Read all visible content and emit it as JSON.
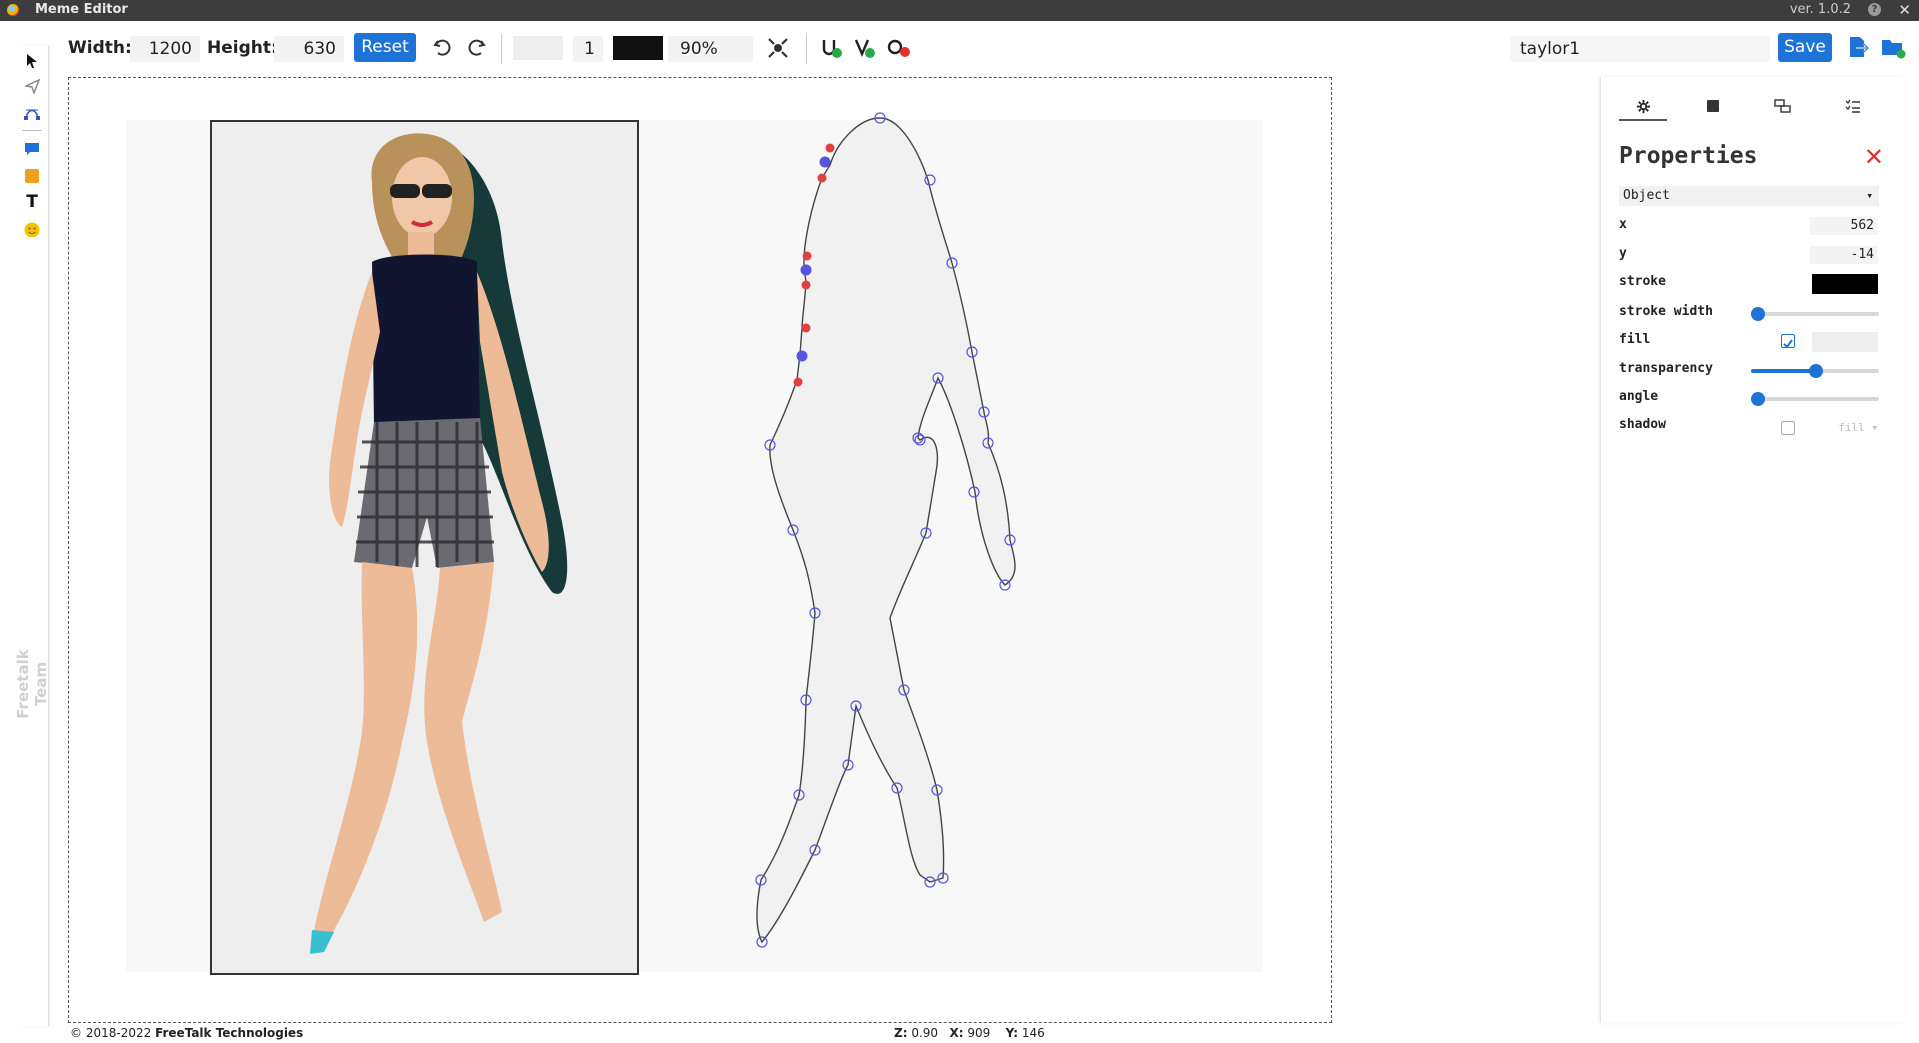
{
  "window": {
    "title": "Meme Editor",
    "version": "ver. 1.0.2",
    "help_icon": "help-icon",
    "close_glyph": "✕"
  },
  "toolbar": {
    "width_label": "Width:",
    "width_value": "1200",
    "height_label": "Height:",
    "height_value": "630",
    "reset_label": "Reset",
    "stroke_width_value": "1",
    "zoom_value": "90%",
    "filename": "taylor1",
    "save_label": "Save",
    "fill_color": "#eeeeee",
    "stroke_color": "#111111"
  },
  "left_tools": [
    "pointer-icon",
    "send-icon",
    "path-edit-icon",
    "speech-bubble-icon",
    "rectangle-icon",
    "text-icon",
    "emoji-icon"
  ],
  "left_vertical_text": "Freetalk Team",
  "properties": {
    "tabs": [
      "gear-icon",
      "square-icon",
      "layers-icon",
      "checklist-icon"
    ],
    "title": "Properties",
    "object_type": "Object",
    "rows": {
      "x_label": "x",
      "x_value": "562",
      "y_label": "y",
      "y_value": "-14",
      "stroke_label": "stroke",
      "stroke_color": "#000000",
      "stroke_width_label": "stroke width",
      "stroke_width_level": 0.0,
      "fill_label": "fill",
      "fill_checked": true,
      "fill_color": "#eeeeee",
      "transparency_label": "transparency",
      "transparency_level": 0.5,
      "angle_label": "angle",
      "angle_level": 0.0,
      "shadow_label": "shadow",
      "shadow_checked": false,
      "shadow_mode": "fill"
    }
  },
  "status": {
    "copyright_prefix": "© 2018-2022",
    "company": "FreeTalk Technologies",
    "z_label": "Z:",
    "z_value": "0.90",
    "x_label": "X:",
    "x_value": "909",
    "y_label": "Y:",
    "y_value": "146"
  },
  "colors": {
    "accent": "#1e73d6",
    "close_red": "#e03030",
    "node_blue": "#5555dd",
    "node_red": "#e04040"
  }
}
